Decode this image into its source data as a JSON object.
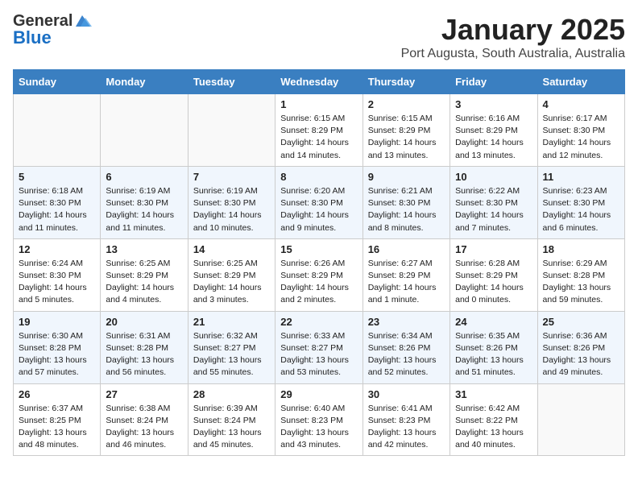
{
  "header": {
    "logo_general": "General",
    "logo_blue": "Blue",
    "month_title": "January 2025",
    "location": "Port Augusta, South Australia, Australia"
  },
  "weekdays": [
    "Sunday",
    "Monday",
    "Tuesday",
    "Wednesday",
    "Thursday",
    "Friday",
    "Saturday"
  ],
  "weeks": [
    {
      "row_class": "row-odd",
      "days": [
        {
          "num": "",
          "info": "",
          "empty": true
        },
        {
          "num": "",
          "info": "",
          "empty": true
        },
        {
          "num": "",
          "info": "",
          "empty": true
        },
        {
          "num": "1",
          "info": "Sunrise: 6:15 AM\nSunset: 8:29 PM\nDaylight: 14 hours\nand 14 minutes."
        },
        {
          "num": "2",
          "info": "Sunrise: 6:15 AM\nSunset: 8:29 PM\nDaylight: 14 hours\nand 13 minutes."
        },
        {
          "num": "3",
          "info": "Sunrise: 6:16 AM\nSunset: 8:29 PM\nDaylight: 14 hours\nand 13 minutes."
        },
        {
          "num": "4",
          "info": "Sunrise: 6:17 AM\nSunset: 8:30 PM\nDaylight: 14 hours\nand 12 minutes."
        }
      ]
    },
    {
      "row_class": "row-even",
      "days": [
        {
          "num": "5",
          "info": "Sunrise: 6:18 AM\nSunset: 8:30 PM\nDaylight: 14 hours\nand 11 minutes."
        },
        {
          "num": "6",
          "info": "Sunrise: 6:19 AM\nSunset: 8:30 PM\nDaylight: 14 hours\nand 11 minutes."
        },
        {
          "num": "7",
          "info": "Sunrise: 6:19 AM\nSunset: 8:30 PM\nDaylight: 14 hours\nand 10 minutes."
        },
        {
          "num": "8",
          "info": "Sunrise: 6:20 AM\nSunset: 8:30 PM\nDaylight: 14 hours\nand 9 minutes."
        },
        {
          "num": "9",
          "info": "Sunrise: 6:21 AM\nSunset: 8:30 PM\nDaylight: 14 hours\nand 8 minutes."
        },
        {
          "num": "10",
          "info": "Sunrise: 6:22 AM\nSunset: 8:30 PM\nDaylight: 14 hours\nand 7 minutes."
        },
        {
          "num": "11",
          "info": "Sunrise: 6:23 AM\nSunset: 8:30 PM\nDaylight: 14 hours\nand 6 minutes."
        }
      ]
    },
    {
      "row_class": "row-odd",
      "days": [
        {
          "num": "12",
          "info": "Sunrise: 6:24 AM\nSunset: 8:30 PM\nDaylight: 14 hours\nand 5 minutes."
        },
        {
          "num": "13",
          "info": "Sunrise: 6:25 AM\nSunset: 8:29 PM\nDaylight: 14 hours\nand 4 minutes."
        },
        {
          "num": "14",
          "info": "Sunrise: 6:25 AM\nSunset: 8:29 PM\nDaylight: 14 hours\nand 3 minutes."
        },
        {
          "num": "15",
          "info": "Sunrise: 6:26 AM\nSunset: 8:29 PM\nDaylight: 14 hours\nand 2 minutes."
        },
        {
          "num": "16",
          "info": "Sunrise: 6:27 AM\nSunset: 8:29 PM\nDaylight: 14 hours\nand 1 minute."
        },
        {
          "num": "17",
          "info": "Sunrise: 6:28 AM\nSunset: 8:29 PM\nDaylight: 14 hours\nand 0 minutes."
        },
        {
          "num": "18",
          "info": "Sunrise: 6:29 AM\nSunset: 8:28 PM\nDaylight: 13 hours\nand 59 minutes."
        }
      ]
    },
    {
      "row_class": "row-even",
      "days": [
        {
          "num": "19",
          "info": "Sunrise: 6:30 AM\nSunset: 8:28 PM\nDaylight: 13 hours\nand 57 minutes."
        },
        {
          "num": "20",
          "info": "Sunrise: 6:31 AM\nSunset: 8:28 PM\nDaylight: 13 hours\nand 56 minutes."
        },
        {
          "num": "21",
          "info": "Sunrise: 6:32 AM\nSunset: 8:27 PM\nDaylight: 13 hours\nand 55 minutes."
        },
        {
          "num": "22",
          "info": "Sunrise: 6:33 AM\nSunset: 8:27 PM\nDaylight: 13 hours\nand 53 minutes."
        },
        {
          "num": "23",
          "info": "Sunrise: 6:34 AM\nSunset: 8:26 PM\nDaylight: 13 hours\nand 52 minutes."
        },
        {
          "num": "24",
          "info": "Sunrise: 6:35 AM\nSunset: 8:26 PM\nDaylight: 13 hours\nand 51 minutes."
        },
        {
          "num": "25",
          "info": "Sunrise: 6:36 AM\nSunset: 8:26 PM\nDaylight: 13 hours\nand 49 minutes."
        }
      ]
    },
    {
      "row_class": "row-odd",
      "days": [
        {
          "num": "26",
          "info": "Sunrise: 6:37 AM\nSunset: 8:25 PM\nDaylight: 13 hours\nand 48 minutes."
        },
        {
          "num": "27",
          "info": "Sunrise: 6:38 AM\nSunset: 8:24 PM\nDaylight: 13 hours\nand 46 minutes."
        },
        {
          "num": "28",
          "info": "Sunrise: 6:39 AM\nSunset: 8:24 PM\nDaylight: 13 hours\nand 45 minutes."
        },
        {
          "num": "29",
          "info": "Sunrise: 6:40 AM\nSunset: 8:23 PM\nDaylight: 13 hours\nand 43 minutes."
        },
        {
          "num": "30",
          "info": "Sunrise: 6:41 AM\nSunset: 8:23 PM\nDaylight: 13 hours\nand 42 minutes."
        },
        {
          "num": "31",
          "info": "Sunrise: 6:42 AM\nSunset: 8:22 PM\nDaylight: 13 hours\nand 40 minutes."
        },
        {
          "num": "",
          "info": "",
          "empty": true
        }
      ]
    }
  ]
}
